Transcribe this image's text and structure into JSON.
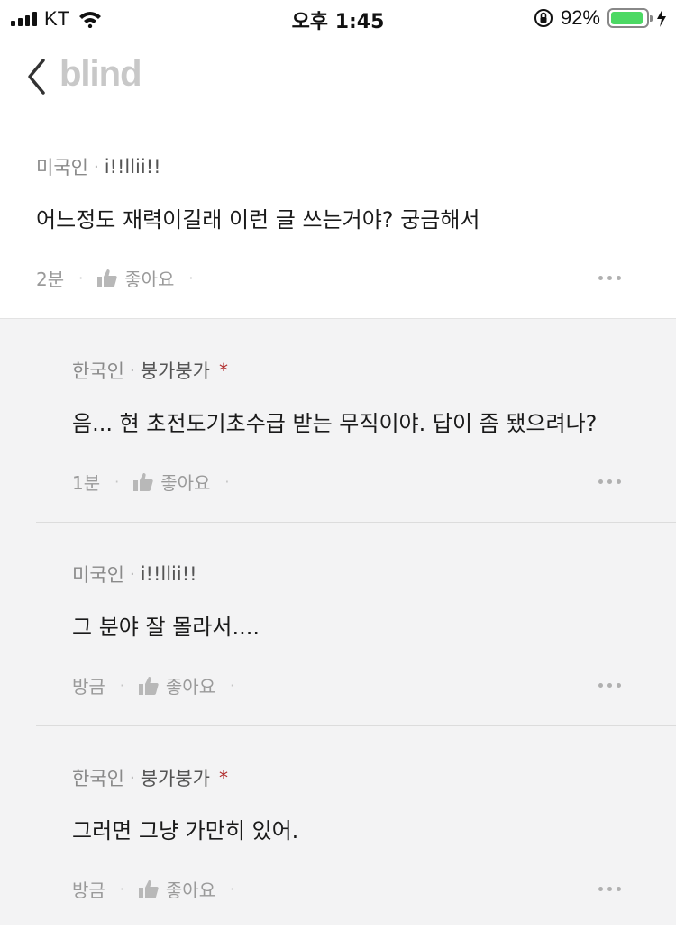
{
  "status_bar": {
    "carrier": "KT",
    "time": "오후 1:45",
    "battery_percent_label": "92%",
    "battery_level": 0.92,
    "icons": [
      "signal-icon",
      "wifi-icon",
      "rotation-lock-icon",
      "battery-icon",
      "charging-icon"
    ]
  },
  "nav": {
    "brand": "blind",
    "back_icon": "chevron-left-icon"
  },
  "comment": {
    "company": "미국인",
    "nickname": "i!!llii!!",
    "text": "어느정도 재력이길래 이런 글 쓰는거야? 궁금해서",
    "time": "2분",
    "like_label": "좋아요"
  },
  "replies": [
    {
      "company": "한국인",
      "nickname": "붕가붕가",
      "author_mark": "*",
      "text": "음... 현 초전도기초수급 받는 무직이야.  답이 좀 됐으려나?",
      "time": "1분",
      "like_label": "좋아요"
    },
    {
      "company": "미국인",
      "nickname": "i!!llii!!",
      "author_mark": "",
      "text": "그 분야 잘 몰라서....",
      "time": "방금",
      "like_label": "좋아요"
    },
    {
      "company": "한국인",
      "nickname": "붕가붕가",
      "author_mark": "*",
      "text": "그러면 그냥 가만히 있어.",
      "time": "방금",
      "like_label": "좋아요"
    }
  ],
  "colors": {
    "reply_background": "#f3f3f4",
    "battery_fill": "#4cd964",
    "author_mark": "#b02a2a"
  }
}
